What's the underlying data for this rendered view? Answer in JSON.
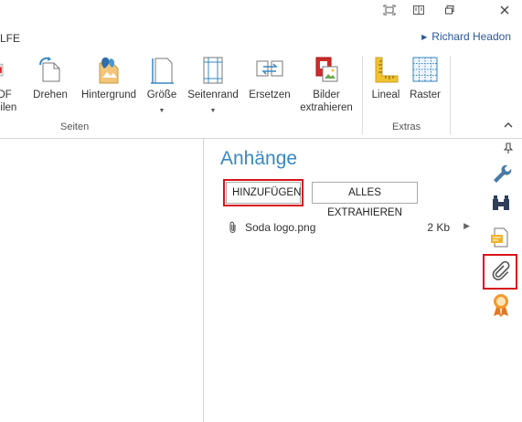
{
  "window": {
    "user_name": "Richard Headon",
    "tab_partial": "LFE",
    "controls": [
      "fullscreen-icon",
      "restore-icon",
      "minimize-icon",
      "close-icon"
    ]
  },
  "ribbon": {
    "groups": [
      {
        "label": "Seiten",
        "buttons": [
          {
            "id": "pdf",
            "label_1": "DF",
            "label_2": "eilen",
            "icon": "pdf-split-icon"
          },
          {
            "id": "rotate",
            "label_1": "Drehen",
            "icon": "rotate-page-icon"
          },
          {
            "id": "background",
            "label_1": "Hintergrund",
            "icon": "background-icon"
          },
          {
            "id": "size",
            "label_1": "Größe",
            "icon": "page-size-icon",
            "dropdown": true
          },
          {
            "id": "margin",
            "label_1": "Seitenrand",
            "icon": "page-margin-icon",
            "dropdown": true
          },
          {
            "id": "replace",
            "label_1": "Ersetzen",
            "icon": "replace-pages-icon"
          },
          {
            "id": "images",
            "label_1": "Bilder",
            "label_2": "extrahieren",
            "icon": "extract-images-icon"
          }
        ]
      },
      {
        "label": "Extras",
        "buttons": [
          {
            "id": "ruler",
            "label_1": "Lineal",
            "icon": "ruler-icon"
          },
          {
            "id": "grid",
            "label_1": "Raster",
            "icon": "grid-icon"
          }
        ]
      }
    ]
  },
  "attachments_panel": {
    "title": "Anhänge",
    "add_button": "HINZUFÜGEN",
    "extract_all_button": "ALLES EXTRAHIEREN",
    "items": [
      {
        "name": "Soda logo.png",
        "size": "2 Kb"
      }
    ]
  },
  "sidebar": {
    "icons": [
      "pin-icon",
      "wrench-icon",
      "binoculars-icon",
      "comments-icon",
      "paperclip-icon",
      "award-icon"
    ],
    "active": "paperclip-icon"
  },
  "colors": {
    "accent": "#3a87c2",
    "highlight": "#d8141a",
    "user_link": "#2b5797"
  }
}
